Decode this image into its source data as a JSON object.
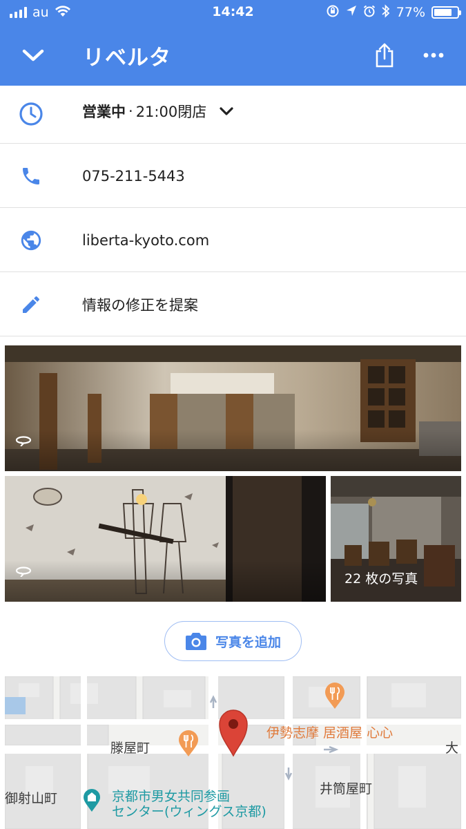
{
  "status_bar": {
    "carrier": "au",
    "time": "14:42",
    "battery": "77%",
    "battery_level": 0.77
  },
  "app_bar": {
    "title": "リベルタ",
    "back_icon": "chevron-down-icon",
    "share_icon": "share-icon",
    "more_icon": "more-horiz-icon"
  },
  "info": {
    "hours": {
      "icon": "clock-icon",
      "status": "営業中",
      "separator": "·",
      "detail": "21:00閉店"
    },
    "phone": {
      "icon": "phone-icon",
      "text": "075-211-5443"
    },
    "website": {
      "icon": "globe-icon",
      "text": "liberta-kyoto.com"
    },
    "suggest_edit": {
      "icon": "pencil-icon",
      "text": "情報の修正を提案"
    }
  },
  "photos": {
    "count_label": "22 枚の写真",
    "pano_icon": "panorama-360-icon"
  },
  "add_photo": {
    "icon": "camera-icon",
    "label": "写真を追加"
  },
  "map": {
    "labels": {
      "area_1": "滕屋町",
      "area_2": "御射山町",
      "area_3": "井筒屋町",
      "area_4": "大",
      "restaurant": "伊勢志摩 居酒屋 心心",
      "civic_line1": "京都市男女共同参画",
      "civic_line2": "センター(ウィングス京都)"
    }
  },
  "colors": {
    "accent": "#4a86e8",
    "pin": "#db4437",
    "food_poi": "#f29b55",
    "civic_poi": "#1e9aa3"
  }
}
